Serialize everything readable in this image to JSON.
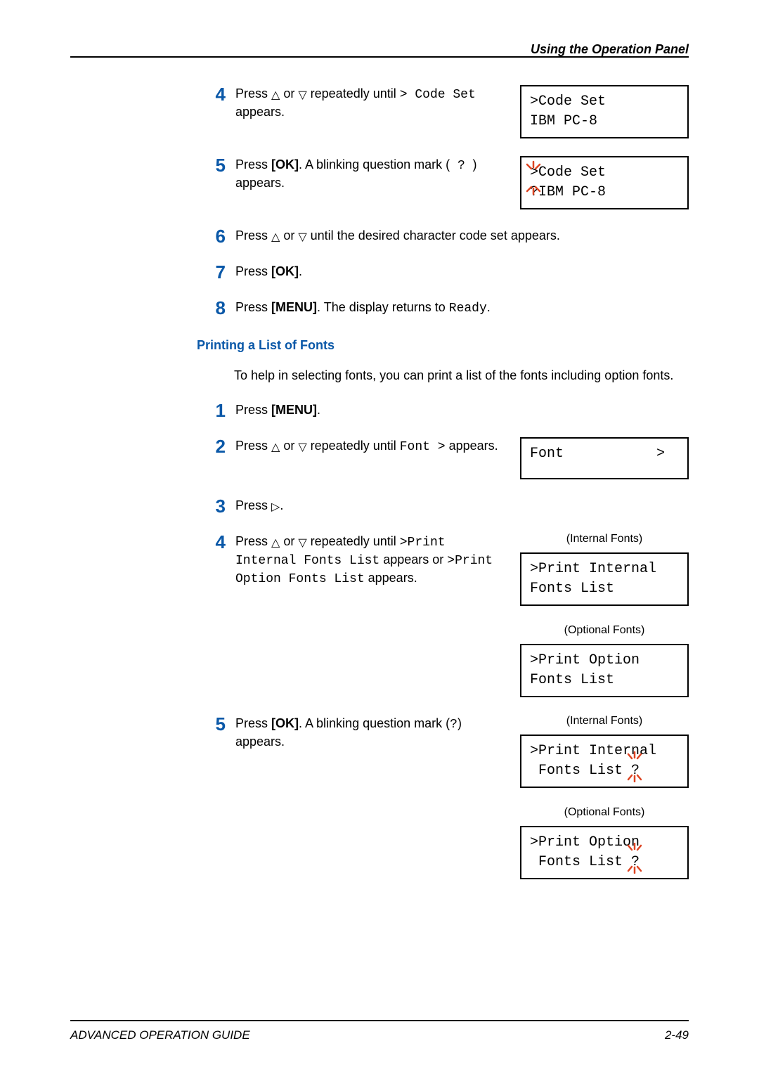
{
  "header": "Using the Operation Panel",
  "section_a": {
    "steps": [
      {
        "num": "4",
        "segments": [
          "Press ",
          "△",
          " or ",
          "▽",
          " repeatedly until ",
          "> Code Set",
          " appears."
        ],
        "lcd": {
          "line1": ">Code Set",
          "line2": " IBM PC-8"
        }
      },
      {
        "num": "5",
        "segments": [
          "Press ",
          "[OK]",
          ". A blinking question mark (",
          " ? ",
          ") appears."
        ],
        "lcd": {
          "line1": ">Code Set",
          "line2": "?IBM PC-8",
          "blink_leading": true
        }
      },
      {
        "num": "6",
        "segments": [
          "Press ",
          "△",
          " or ",
          "▽",
          " until the desired character code set appears."
        ]
      },
      {
        "num": "7",
        "segments": [
          "Press ",
          "[OK]",
          "."
        ]
      },
      {
        "num": "8",
        "segments": [
          "Press ",
          "[MENU]",
          ". The display returns to ",
          "Ready",
          "."
        ]
      }
    ]
  },
  "section_b": {
    "title": "Printing a List of Fonts",
    "intro": "To help in selecting fonts, you can print a list of the fonts including option fonts.",
    "steps": [
      {
        "num": "1",
        "segments": [
          "Press ",
          "[MENU]",
          "."
        ]
      },
      {
        "num": "2",
        "segments": [
          "Press ",
          "△",
          " or ",
          "▽",
          " repeatedly until ",
          "Font >",
          " appears."
        ],
        "lcd": {
          "line1": "Font           >",
          "line2": ""
        }
      },
      {
        "num": "3",
        "segments": [
          "Press ",
          "▷",
          "."
        ]
      },
      {
        "num": "4",
        "segments": [
          "Press ",
          "△",
          " or ",
          "▽",
          " repeatedly until ",
          ">Print Internal Fonts List",
          " appears or ",
          ">Print Option Fonts List",
          " appears."
        ],
        "lcds": [
          {
            "label": "(Internal Fonts)",
            "line1": ">Print Internal",
            "line2": " Fonts List"
          },
          {
            "label": "(Optional Fonts)",
            "line1": ">Print Option",
            "line2": " Fonts List"
          }
        ]
      },
      {
        "num": "5",
        "segments": [
          "Press ",
          "[OK]",
          ". A blinking question mark (",
          "?",
          ") appears."
        ],
        "lcds": [
          {
            "label": "(Internal Fonts)",
            "line1": ">Print Internal",
            "line2": " Fonts List ?",
            "blink_trailing": true
          },
          {
            "label": "(Optional Fonts)",
            "line1": ">Print Option",
            "line2": " Fonts List ?",
            "blink_trailing": true
          }
        ]
      }
    ]
  },
  "footer": {
    "left": "ADVANCED OPERATION GUIDE",
    "right": "2-49"
  }
}
